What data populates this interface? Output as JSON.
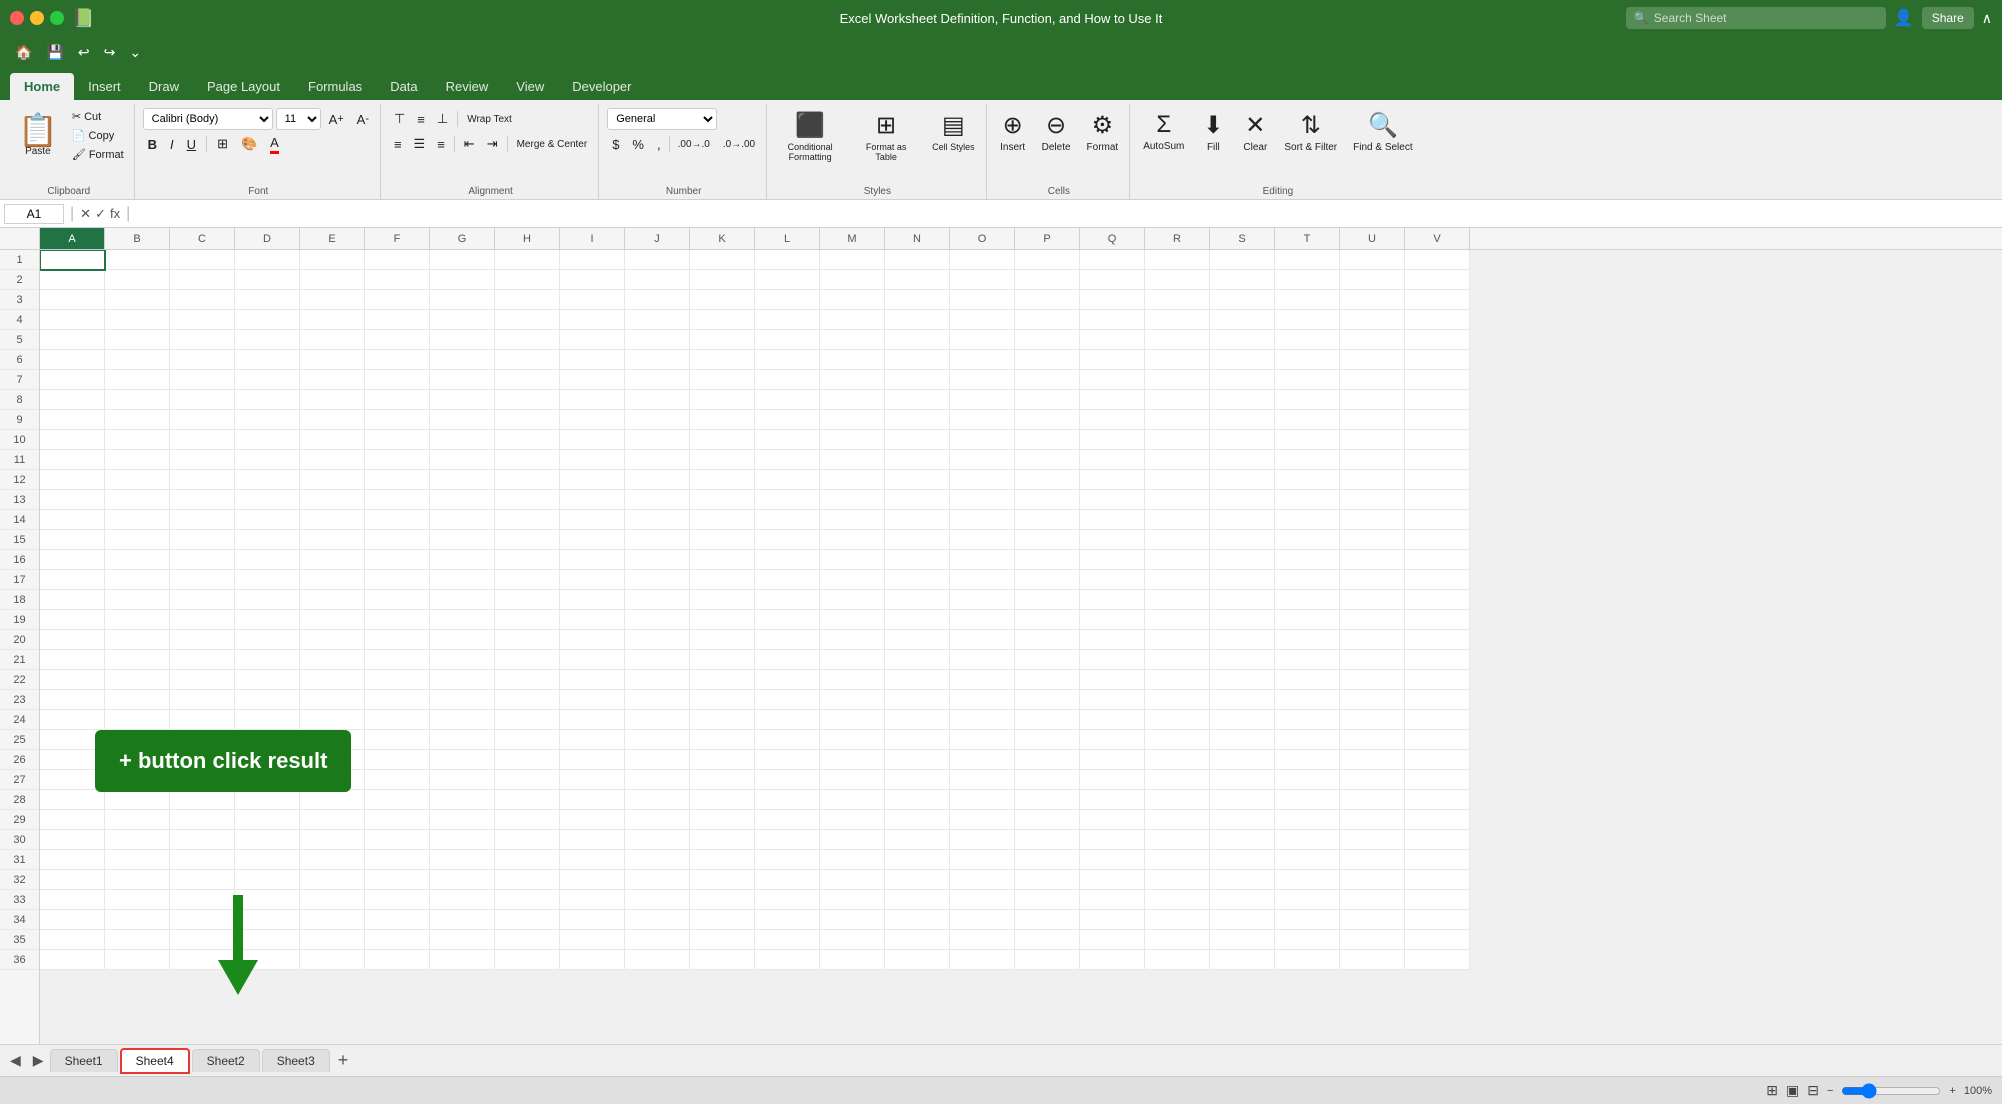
{
  "titleBar": {
    "title": "Excel Worksheet Definition, Function, and How to Use It",
    "searchPlaceholder": "Search Sheet",
    "shareLabel": "Share",
    "trafficLights": [
      "close",
      "minimize",
      "maximize"
    ]
  },
  "qat": {
    "buttons": [
      "🏠",
      "💾",
      "↩",
      "↪",
      "⌄"
    ]
  },
  "ribbonTabs": {
    "tabs": [
      "Home",
      "Insert",
      "Draw",
      "Page Layout",
      "Formulas",
      "Data",
      "Review",
      "View",
      "Developer"
    ],
    "activeTab": "Home"
  },
  "ribbon": {
    "clipboard": {
      "label": "Clipboard",
      "pasteLabel": "Paste",
      "cutLabel": "Cut",
      "copyLabel": "Copy",
      "formatLabel": "Format"
    },
    "font": {
      "label": "Font",
      "fontName": "Calibri (Body)",
      "fontSize": "11",
      "boldLabel": "B",
      "italicLabel": "I",
      "underlineLabel": "U",
      "increaseFontLabel": "A↑",
      "decreaseFontLabel": "A↓",
      "fontColorLabel": "A"
    },
    "alignment": {
      "label": "Alignment",
      "wrapTextLabel": "Wrap Text",
      "mergeCenterLabel": "Merge & Center"
    },
    "number": {
      "label": "Number",
      "formatLabel": "General",
      "currencyLabel": "$",
      "percentLabel": "%",
      "commaLabel": ","
    },
    "styles": {
      "label": "Styles",
      "conditionalFormattingLabel": "Conditional Formatting",
      "formatAsTableLabel": "Format as Table",
      "cellStylesLabel": "Cell Styles"
    },
    "cells": {
      "label": "Cells",
      "insertLabel": "Insert",
      "deleteLabel": "Delete",
      "formatLabel": "Format"
    },
    "editing": {
      "label": "Editing",
      "autoSumLabel": "AutoSum",
      "fillLabel": "Fill",
      "clearLabel": "Clear",
      "sortFilterLabel": "Sort & Filter",
      "findSelectLabel": "Find & Select"
    }
  },
  "formulaBar": {
    "cellRef": "A1",
    "formula": ""
  },
  "columns": [
    "A",
    "B",
    "C",
    "D",
    "E",
    "F",
    "G",
    "H",
    "I",
    "J",
    "K",
    "L",
    "M",
    "N",
    "O",
    "P",
    "Q",
    "R",
    "S",
    "T",
    "U",
    "V"
  ],
  "rows": [
    1,
    2,
    3,
    4,
    5,
    6,
    7,
    8,
    9,
    10,
    11,
    12,
    13,
    14,
    15,
    16,
    17,
    18,
    19,
    20,
    21,
    22,
    23,
    24,
    25,
    26,
    27,
    28,
    29,
    30,
    31,
    32,
    33,
    34,
    35,
    36
  ],
  "selectedCell": "A1",
  "annotation": {
    "text": "+ button click result",
    "arrowColor": "#1a8a1a"
  },
  "sheetTabs": {
    "tabs": [
      "Sheet1",
      "Sheet4",
      "Sheet2",
      "Sheet3"
    ],
    "activeTab": "Sheet4",
    "highlightedTab": "Sheet4",
    "addLabel": "+"
  },
  "statusBar": {
    "leftText": "",
    "viewNormal": "⊞",
    "viewPage": "▣",
    "viewBreak": "⊟",
    "zoomLevel": "100%"
  },
  "colors": {
    "excelGreen": "#217346",
    "ribbonBg": "#f0f0f0",
    "titleBarGreen": "#2b6e2b",
    "annotationGreen": "#1a7a1a",
    "arrowGreen": "#1a8a1a"
  }
}
